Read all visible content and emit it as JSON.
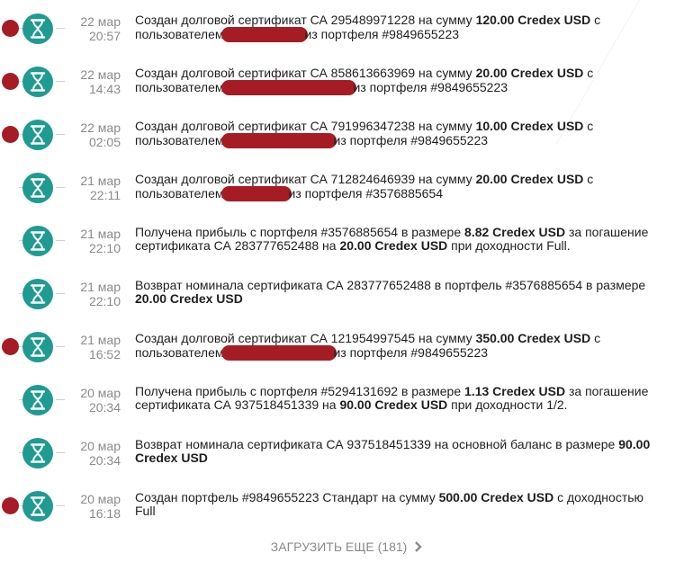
{
  "feed": {
    "items": [
      {
        "has_dot": true,
        "date": "22 мар",
        "time": "20:57",
        "line1": [
          "Создан долговой сертификат СА 295489971228 на сумму ",
          "120.00 Credex USD",
          " с"
        ],
        "line2_pre": "пользователем",
        "redact_w": 96,
        "line2_post": "из портфеля #9849655223"
      },
      {
        "has_dot": true,
        "date": "22 мар",
        "time": "14:43",
        "line1": [
          "Создан долговой сертификат СА 858613663969 на сумму ",
          "20.00 Credex USD",
          " с"
        ],
        "line2_pre": "пользователем",
        "redact_w": 150,
        "line2_post": "из портфеля #9849655223"
      },
      {
        "has_dot": true,
        "date": "22 мар",
        "time": "02:05",
        "line1": [
          "Создан долговой сертификат СА 791996347238 на сумму ",
          "10.00 Credex USD",
          " с"
        ],
        "line2_pre": "пользователем",
        "redact_w": 128,
        "line2_post": "из портфеля #9849655223"
      },
      {
        "has_dot": false,
        "date": "21 мар",
        "time": "22:11",
        "line1": [
          "Создан долговой сертификат СА 712824646939 на сумму ",
          "20.00 Credex USD",
          " с"
        ],
        "line2_pre": "пользователем",
        "redact_w": 78,
        "line2_post": "из портфеля #3576885654"
      },
      {
        "has_dot": false,
        "date": "21 мар",
        "time": "22:10",
        "rich": [
          [
            "Получена прибыль с портфеля #3576885654 в размере ",
            "8.82 Credex USD",
            " за погашение"
          ],
          [
            "сертификата СА 283777652488 на ",
            "20.00 Credex USD",
            " при доходности Full."
          ]
        ]
      },
      {
        "has_dot": false,
        "date": "21 мар",
        "time": "22:10",
        "rich": [
          [
            "Возврат номинала сертификата СА 283777652488 в портфель #3576885654 в размере",
            "",
            ""
          ],
          [
            "",
            "20.00 Credex USD",
            ""
          ]
        ]
      },
      {
        "has_dot": true,
        "date": "21 мар",
        "time": "16:52",
        "line1": [
          "Создан долговой сертификат СА 121954997545 на сумму ",
          "350.00 Credex USD",
          " с"
        ],
        "line2_pre": "пользователем",
        "redact_w": 128,
        "line2_post": "из портфеля #9849655223"
      },
      {
        "has_dot": false,
        "date": "20 мар",
        "time": "20:34",
        "rich": [
          [
            "Получена прибыль с портфеля #5294131692 в размере ",
            "1.13 Credex USD",
            " за погашение"
          ],
          [
            "сертификата СА 937518451339 на ",
            "90.00 Credex USD",
            " при доходности 1/2."
          ]
        ]
      },
      {
        "has_dot": false,
        "date": "20 мар",
        "time": "20:34",
        "rich": [
          [
            "Возврат номинала сертификата СА 937518451339 на основной баланс в размере ",
            "90.00",
            ""
          ],
          [
            "",
            "Credex USD",
            ""
          ]
        ]
      },
      {
        "has_dot": true,
        "date": "20 мар",
        "time": "16:18",
        "rich": [
          [
            "Создан портфель #9849655223 Стандарт на сумму ",
            "500.00 Credex USD",
            " с доходностью"
          ],
          [
            "Full",
            "",
            ""
          ]
        ]
      }
    ]
  },
  "load_more": {
    "label": "ЗАГРУЗИТЬ ЕЩЕ (181)"
  },
  "colors": {
    "teal": "#1f9b91",
    "red": "#a61c25",
    "muted": "#8a8a8a"
  },
  "icons": {
    "item_icon": "hourglass-icon",
    "load_more_icon": "chevron-right-icon"
  }
}
